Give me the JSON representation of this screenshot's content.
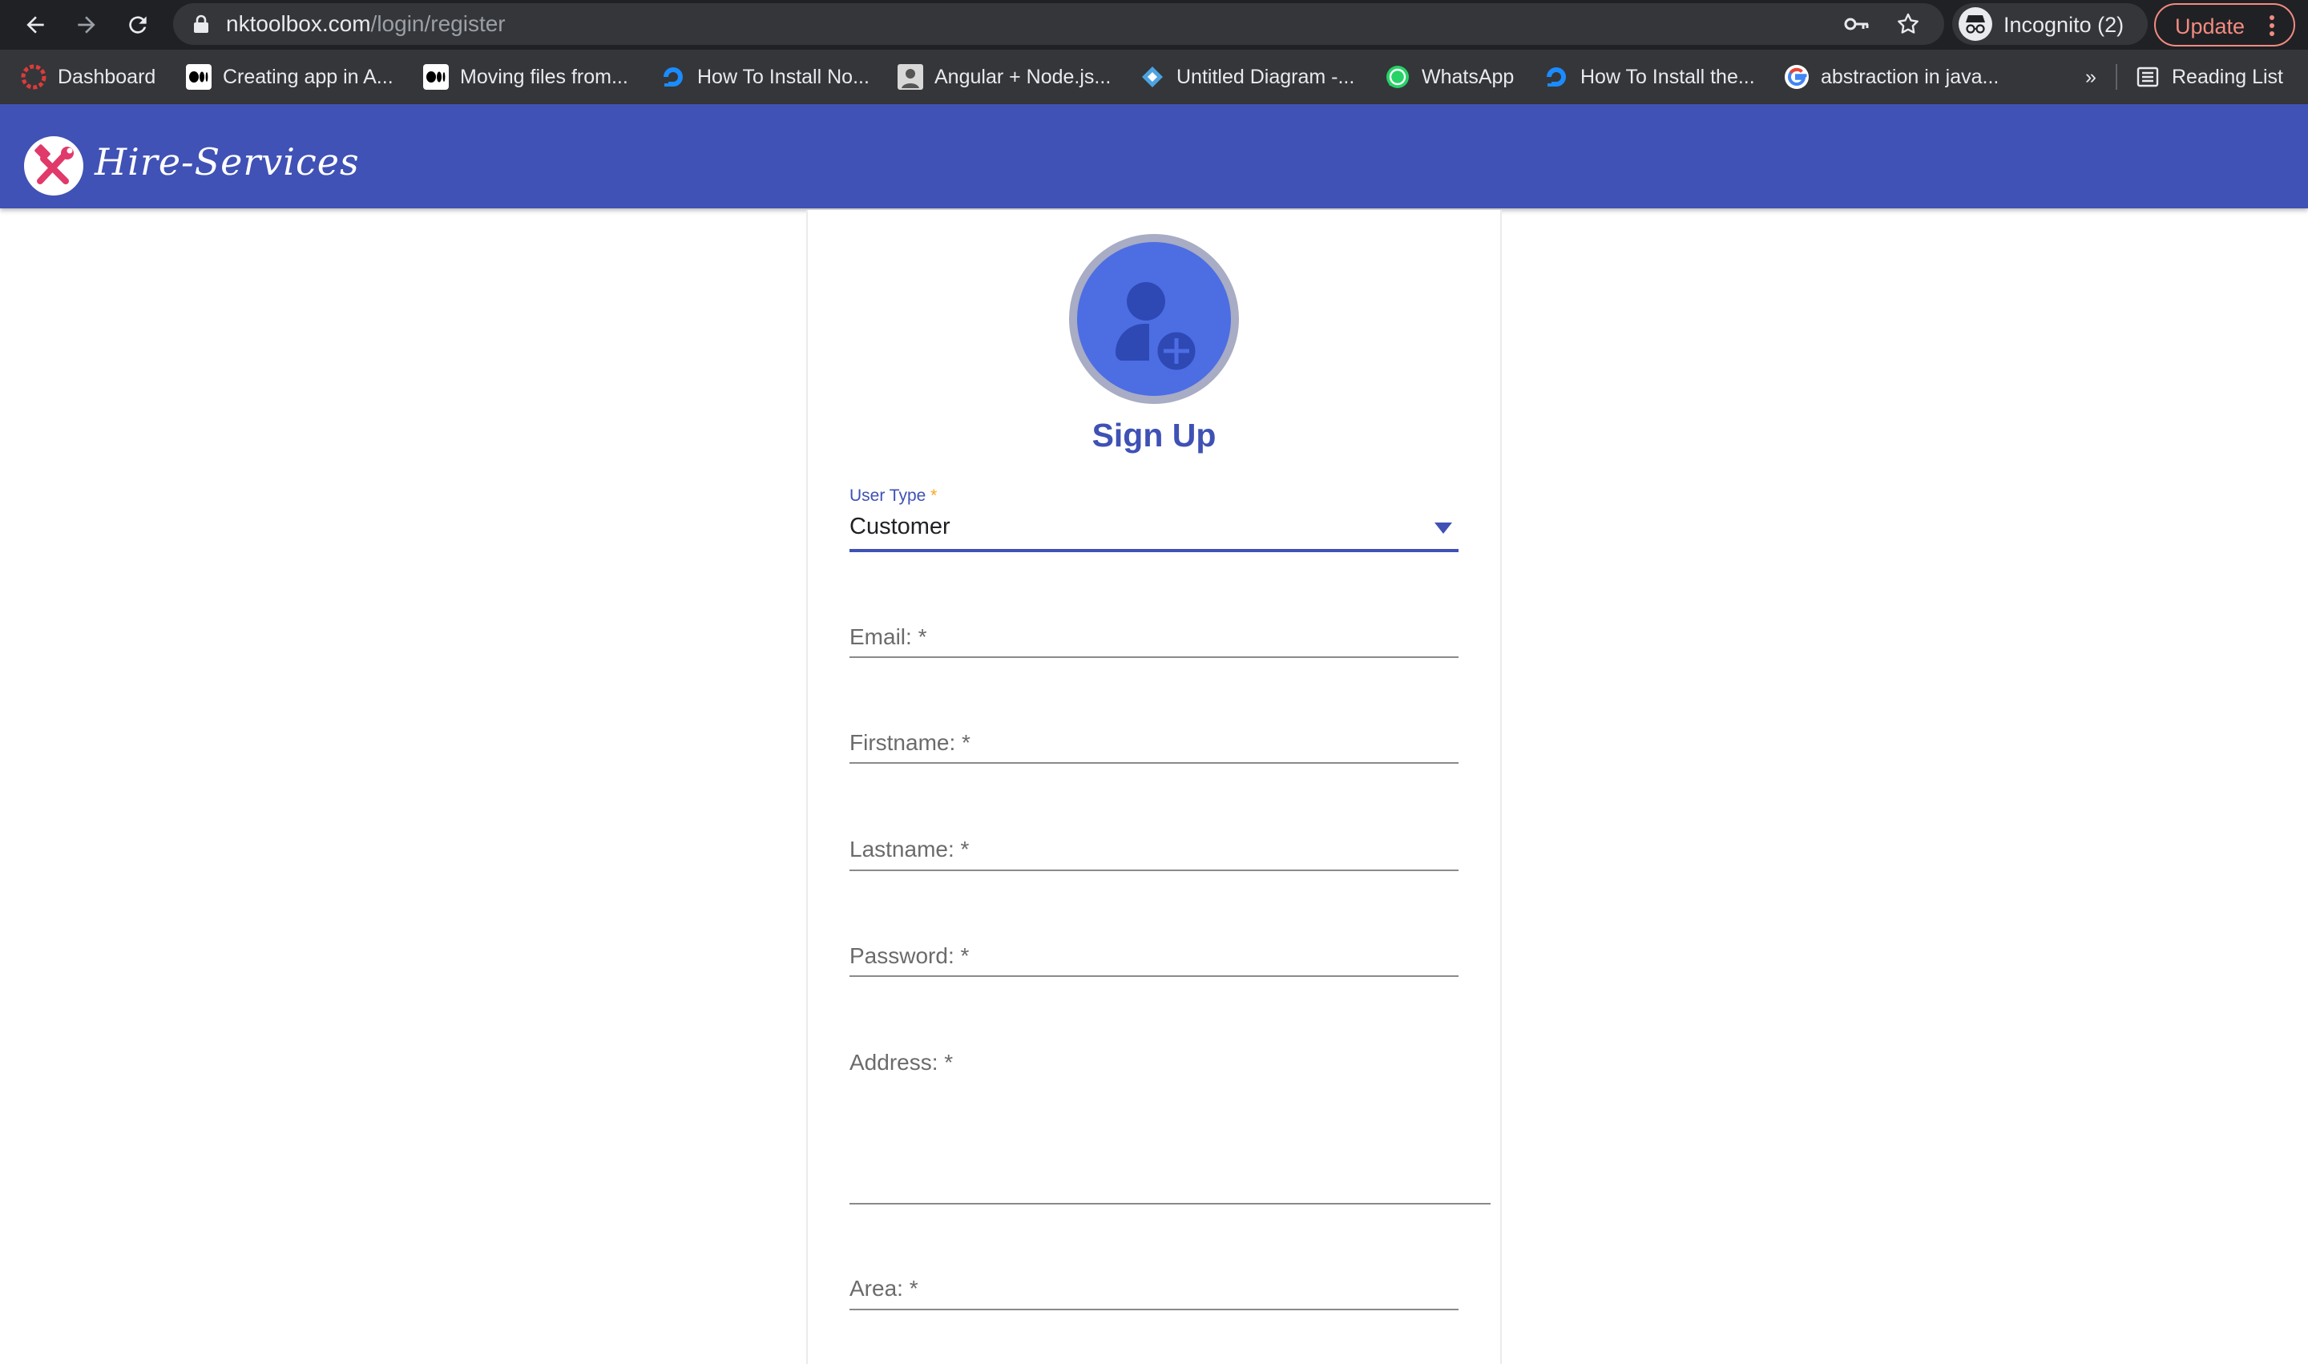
{
  "browser": {
    "url_host": "nktoolbox.com",
    "url_path": "/login/register",
    "profile_label": "Incognito (2)",
    "update_label": "Update",
    "more_bookmarks": "»",
    "reading_list": "Reading List",
    "bookmarks": [
      {
        "label": "Dashboard",
        "icon": "angular-icon"
      },
      {
        "label": "Creating app in A...",
        "icon": "medium-icon"
      },
      {
        "label": "Moving files from...",
        "icon": "medium-icon"
      },
      {
        "label": "How To Install No...",
        "icon": "digitalocean-icon"
      },
      {
        "label": "Angular + Node.js...",
        "icon": "avatar-icon"
      },
      {
        "label": "Untitled Diagram -...",
        "icon": "drawio-icon"
      },
      {
        "label": "WhatsApp",
        "icon": "whatsapp-icon"
      },
      {
        "label": "How To Install the...",
        "icon": "digitalocean-icon"
      },
      {
        "label": "abstraction in java...",
        "icon": "google-icon"
      }
    ]
  },
  "app": {
    "brand": "Hire-Services",
    "colors": {
      "appbar": "#4052b5",
      "accent": "#3f51b5",
      "avatar": "#4d6de3"
    }
  },
  "form": {
    "title": "Sign Up",
    "user_type": {
      "label": "User Type",
      "required_mark": "*",
      "value": "Customer"
    },
    "fields": {
      "email": "Email: *",
      "firstname": "Firstname: *",
      "lastname": "Lastname: *",
      "password": "Password: *",
      "address": "Address: *",
      "area": "Area: *"
    }
  }
}
